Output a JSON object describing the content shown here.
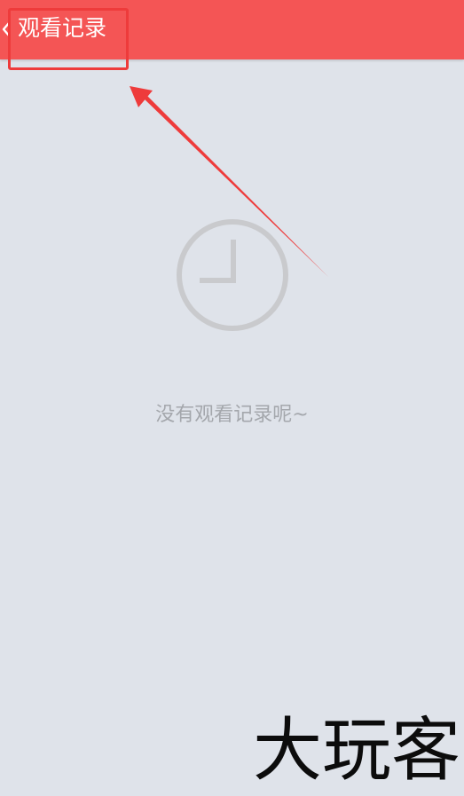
{
  "header": {
    "back_icon": "chevron-left-icon",
    "title": "观看记录",
    "background": "#f45555"
  },
  "annotation": {
    "box_color": "#ee3b3b",
    "arrow_color": "#ee3b3b"
  },
  "empty_state": {
    "icon": "clock-icon",
    "message": "没有观看记录呢~"
  },
  "watermark": {
    "text": "大玩客"
  }
}
